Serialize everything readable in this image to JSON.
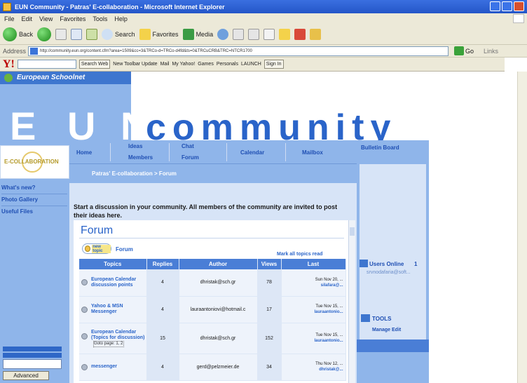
{
  "browser": {
    "title": "EUN Community - Patras' E-collaboration - Microsoft Internet Explorer",
    "menu": [
      "File",
      "Edit",
      "View",
      "Favorites",
      "Tools",
      "Help"
    ],
    "toolbar": {
      "back": "Back",
      "search": "Search",
      "favorites": "Favorites",
      "media": "Media"
    },
    "address_label": "Address",
    "url": "http://community.eun.org/content.cfm?area=1509&cc=3&TRCo-d=TRCo-d4fd&ts=0&TRCuCRB&TRC=NTCR1700",
    "go_label": "Go",
    "links_label": "Links",
    "yahoo": {
      "logo": "Y!",
      "search_web": "Search Web",
      "toolbar_update": "New Toolbar Update",
      "mail": "Mail",
      "my_yahoo": "My Yahoo!",
      "games": "Games",
      "personals": "Personals",
      "launch": "LAUNCH",
      "sign_in": "Sign In"
    }
  },
  "site": {
    "org_name": "European Schoolnet",
    "banner_letters": [
      "E",
      "U",
      "N"
    ],
    "banner_word": "community",
    "logo_text": "E-COLLABORATION"
  },
  "left_nav": {
    "items": [
      "What's new?",
      "Photo Gallery",
      "Useful Files"
    ],
    "button": "Advanced"
  },
  "top_nav": {
    "home": "Home",
    "ideas": "Ideas",
    "members": "Members",
    "chat": "Chat",
    "forum": "Forum",
    "calendar": "Calendar",
    "mailbox": "Mailbox",
    "bulletin": "Bulletin Board"
  },
  "content": {
    "breadcrumb": "Patras' E-collaboration > Forum",
    "intro": "Start a discussion in your community. All members of the community are invited to post their ideas here.",
    "forum_title": "Forum",
    "new_topic": "new topic",
    "forum_crumb": "Forum",
    "mark_all": "Mark all topics read",
    "columns": [
      "Topics",
      "Replies",
      "Author",
      "Views",
      "Last"
    ],
    "rows": [
      {
        "topic": "European Calendar discussion points",
        "page": "",
        "replies": "4",
        "author": "dhristak@sch.gr",
        "views": "78",
        "last_date": "Sun Nov 20, ...",
        "last_by": "silafara@..."
      },
      {
        "topic": "Yahoo & MSN Messenger",
        "page": "",
        "replies": "4",
        "author": "lauraantoniovi@hotmail.c",
        "views": "17",
        "last_date": "Tue Nov 15, ...",
        "last_by": "lauraantonio..."
      },
      {
        "topic": "European Calendar (Topics for discussion)",
        "page": "Goto page: 1, 2",
        "replies": "15",
        "author": "dhristak@sch.gr",
        "views": "152",
        "last_date": "Tue Nov 15, ...",
        "last_by": "lauraantonio..."
      },
      {
        "topic": "messenger",
        "page": "",
        "replies": "4",
        "author": "gerd@pelzmeier.de",
        "views": "34",
        "last_date": "Thu Nov 12, ...",
        "last_by": "dhristak@..."
      }
    ]
  },
  "right_col": {
    "bulletin": "Bulletin Board",
    "users_online": "Users Online",
    "users_count": "1",
    "user_link": "srvnodafaria@soft...",
    "tools": "TOOLS",
    "manage": "Manage Edit"
  }
}
